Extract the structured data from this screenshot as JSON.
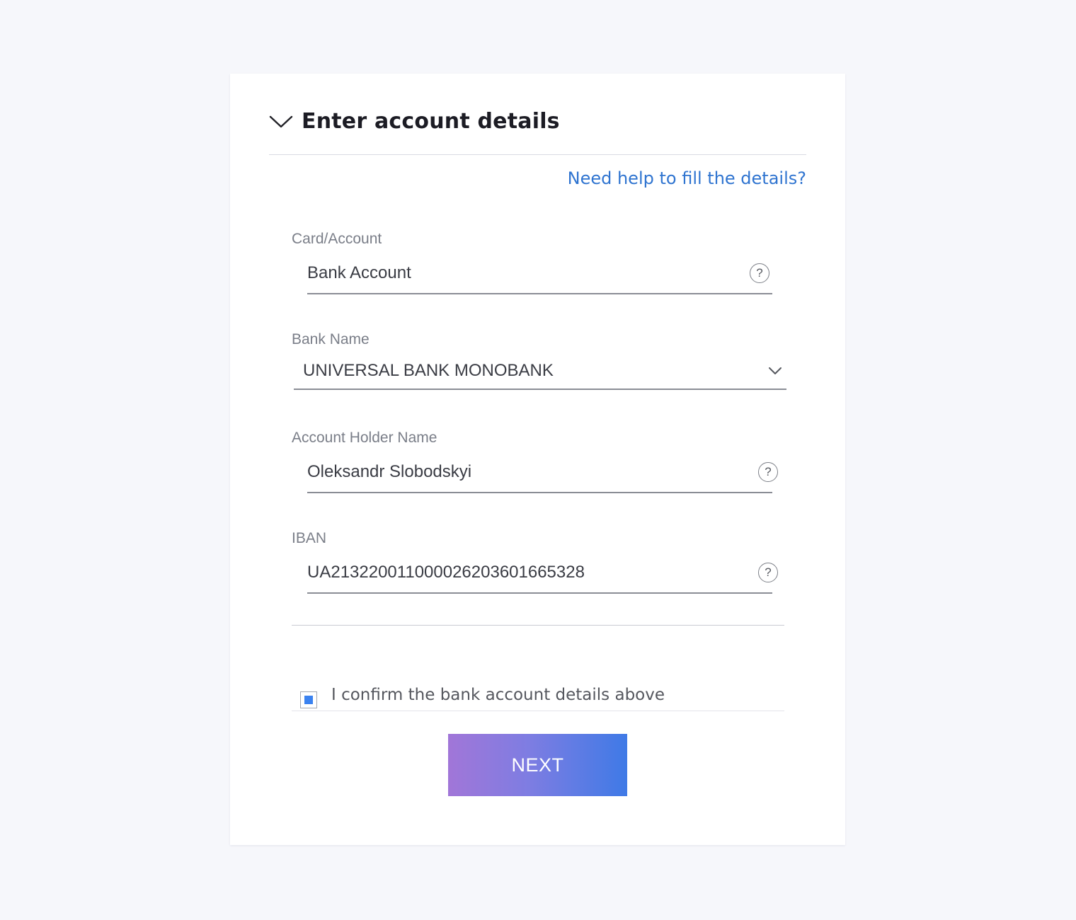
{
  "section": {
    "title": "Enter account details",
    "help_link": "Need help to fill the details?"
  },
  "fields": {
    "card_account": {
      "label": "Card/Account",
      "value": "Bank Account"
    },
    "bank_name": {
      "label": "Bank Name",
      "value": "UNIVERSAL BANK MONOBANK"
    },
    "holder_name": {
      "label": "Account Holder Name",
      "value": "Oleksandr Slobodskyi"
    },
    "iban": {
      "label": "IBAN",
      "value": "UA213220011000026203601665328"
    }
  },
  "help_icon_glyph": "?",
  "confirm": {
    "label": "I confirm the bank account details above",
    "checked": true
  },
  "actions": {
    "next_label": "NEXT"
  },
  "icons": {
    "section_toggle": "chevron-down-icon",
    "dropdown": "chevron-down-icon",
    "help": "help-icon"
  },
  "colors": {
    "page_background": "#f6f7fb",
    "link": "#2f74d0",
    "checkbox_fill": "#3b82f0",
    "button_gradient_start": "#a176d8",
    "button_gradient_end": "#3f7ae6"
  }
}
